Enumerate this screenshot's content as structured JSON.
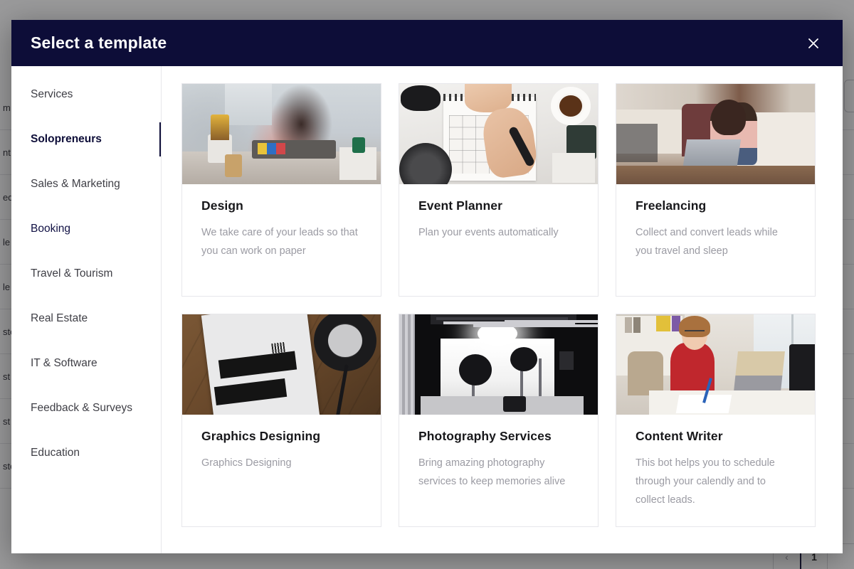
{
  "modal": {
    "title": "Select a template",
    "close_icon": "close-icon"
  },
  "sidebar": {
    "items": [
      {
        "label": "Services",
        "state": "normal"
      },
      {
        "label": "Solopreneurs",
        "state": "active"
      },
      {
        "label": "Sales & Marketing",
        "state": "normal"
      },
      {
        "label": "Booking",
        "state": "accent"
      },
      {
        "label": "Travel & Tourism",
        "state": "normal"
      },
      {
        "label": "Real Estate",
        "state": "normal"
      },
      {
        "label": "IT & Software",
        "state": "normal"
      },
      {
        "label": "Feedback & Surveys",
        "state": "normal"
      },
      {
        "label": "Education",
        "state": "normal"
      }
    ]
  },
  "templates": [
    {
      "title": "Design",
      "description": "We take care of your leads so that you can work on paper",
      "image": "woman-crafting-at-desk-photo"
    },
    {
      "title": "Event Planner",
      "description": "Plan your events automatically",
      "image": "hand-writing-on-desk-calendar-photo"
    },
    {
      "title": "Freelancing",
      "description": "Collect and convert leads while you travel and sleep",
      "image": "woman-with-laptop-on-living-room-floor-photo"
    },
    {
      "title": "Graphics Designing",
      "description": "Graphics Designing",
      "image": "graphic-design-magazine-with-headphones-photo"
    },
    {
      "title": "Photography Services",
      "description": "Bring amazing photography services to keep memories alive",
      "image": "photography-studio-with-lights-photo"
    },
    {
      "title": "Content Writer",
      "description": "This bot helps you to schedule through your calendly and to collect leads.",
      "image": "woman-in-red-sweater-at-office-desk-photo"
    }
  ],
  "background": {
    "table_rows": [
      "m",
      "nt",
      "ed",
      "le",
      "le",
      "ste",
      "st",
      "st",
      "ste"
    ],
    "pagination": {
      "prev_label": "‹",
      "current_page": "1"
    }
  },
  "colors": {
    "header_navy": "#0d0d38",
    "accent_navy": "#111144",
    "card_border": "#e7e7eb",
    "muted_text": "#9b9ba3",
    "title_text": "#18181b"
  }
}
